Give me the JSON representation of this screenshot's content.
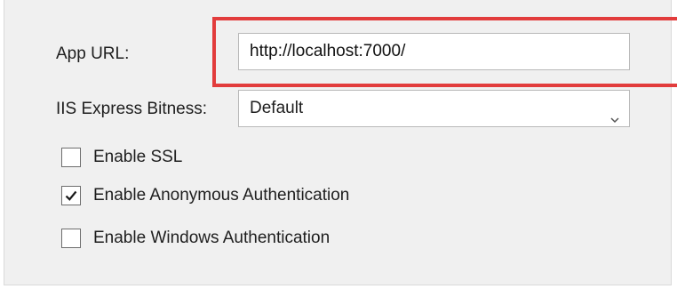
{
  "fields": {
    "app_url_label": "App URL:",
    "app_url_value": "http://localhost:7000/",
    "bitness_label": "IIS Express Bitness:",
    "bitness_selected": "Default"
  },
  "checkboxes": [
    {
      "label": "Enable SSL",
      "checked": false
    },
    {
      "label": "Enable Anonymous Authentication",
      "checked": true
    },
    {
      "label": "Enable Windows Authentication",
      "checked": false
    }
  ],
  "icons": {
    "dropdown": "chevron-down-icon",
    "check": "checkmark-icon"
  },
  "colors": {
    "highlight": "#e23c3c",
    "panel_background": "#f0f0f0"
  }
}
